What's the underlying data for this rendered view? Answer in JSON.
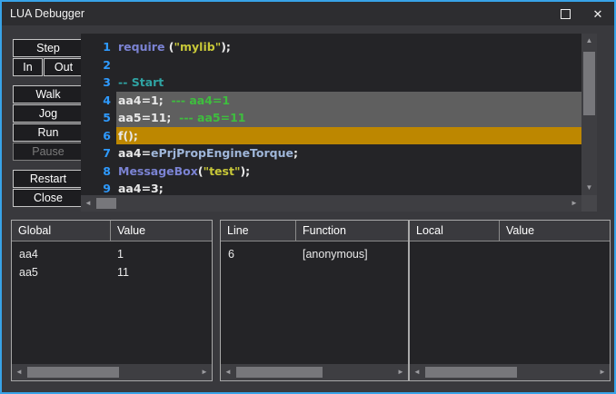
{
  "window": {
    "title": "LUA Debugger"
  },
  "icons": {
    "close": "✕",
    "scroll_up": "▲",
    "scroll_down": "▼",
    "scroll_left": "◄",
    "scroll_right": "►"
  },
  "colors": {
    "window_border": "#38a3e8",
    "current_line_highlight": "#bd8700",
    "selected_line_highlight": "#5f5f5f",
    "line_number": "#2e9afe",
    "keyword": "#7b83d3",
    "string": "#c8c838",
    "comment_teal": "#2fa3a3",
    "comment_green": "#3ebe3e",
    "identifier": "#9fb6d9"
  },
  "toolbar": {
    "step": "Step",
    "in": "In",
    "out": "Out",
    "walk": "Walk",
    "jog": "Jog",
    "run": "Run",
    "pause": "Pause",
    "restart": "Restart",
    "close": "Close"
  },
  "editor": {
    "lines": [
      {
        "number": "1",
        "segments": [
          {
            "text": "require "
          },
          {
            "text": "("
          },
          {
            "text": "\"mylib\""
          },
          {
            "text": ");"
          }
        ]
      },
      {
        "number": "2",
        "segments": []
      },
      {
        "number": "3",
        "segments": [
          {
            "text": "-- Start"
          }
        ]
      },
      {
        "number": "4",
        "highlight": "gray",
        "segments": [
          {
            "text": "aa4=1;  "
          },
          {
            "text": "--- aa4=1"
          }
        ]
      },
      {
        "number": "5",
        "highlight": "gray",
        "segments": [
          {
            "text": "aa5=11;  "
          },
          {
            "text": "--- aa5=11"
          }
        ]
      },
      {
        "number": "6",
        "highlight": "current",
        "segments": [
          {
            "text": "f();"
          }
        ]
      },
      {
        "number": "7",
        "segments": [
          {
            "text": "aa4="
          },
          {
            "text": "ePrjPropEngineTorque"
          },
          {
            "text": ";"
          }
        ]
      },
      {
        "number": "8",
        "segments": [
          {
            "text": "MessageBox"
          },
          {
            "text": "("
          },
          {
            "text": "\"test\""
          },
          {
            "text": ");"
          }
        ]
      },
      {
        "number": "9",
        "segments": [
          {
            "text": "aa4=3;"
          }
        ]
      }
    ]
  },
  "globals_panel": {
    "headers": [
      "Global",
      "Value"
    ],
    "rows": [
      [
        "aa4",
        "1"
      ],
      [
        "aa5",
        "11"
      ]
    ]
  },
  "callstack_panel": {
    "headers": [
      "Line",
      "Function"
    ],
    "rows": [
      [
        "6",
        "[anonymous]"
      ]
    ]
  },
  "locals_panel": {
    "headers": [
      "Local",
      "Value"
    ],
    "rows": []
  }
}
